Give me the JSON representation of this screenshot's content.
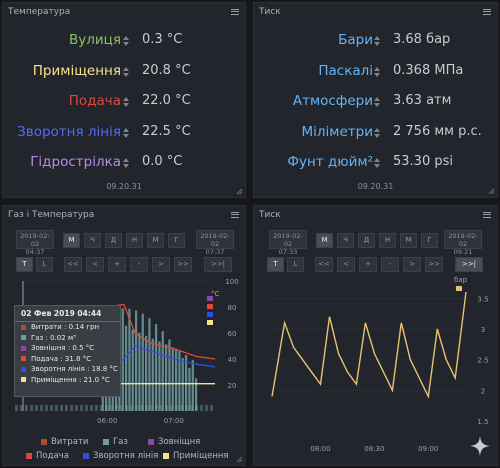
{
  "panels": {
    "temp": {
      "title": "Температура",
      "timestamp": "09.20.31",
      "rows": [
        {
          "label": "Вулиця",
          "value": "0.3 °C",
          "color": "#88c265"
        },
        {
          "label": "Приміщення",
          "value": "20.8 °C",
          "color": "#f2e48e"
        },
        {
          "label": "Подача",
          "value": "22.0 °C",
          "color": "#e0473f"
        },
        {
          "label": "Зворотня лінія",
          "value": "22.5 °C",
          "color": "#4f6ff0"
        },
        {
          "label": "Гідрострілка",
          "value": "0.0 °C",
          "color": "#b98ce8"
        }
      ]
    },
    "pressure": {
      "title": "Тиск",
      "timestamp": "09.20.31",
      "rows": [
        {
          "label": "Бари",
          "value": "3.68 бар",
          "color": "#66b3f4"
        },
        {
          "label": "Паскалі",
          "value": "0.368 МПа",
          "color": "#66b3f4"
        },
        {
          "label": "Атмосфери",
          "value": "3.63 атм",
          "color": "#66b3f4"
        },
        {
          "label": "Міліметри",
          "value": "2 756 мм р.с.",
          "color": "#66b3f4"
        },
        {
          "label": "Фунт дюйм²",
          "value": "53.30 psi",
          "color": "#66b3f4"
        }
      ]
    },
    "gas": {
      "title": "Газ і Температура",
      "date_from": {
        "d": "2019-02-02",
        "t": "04:37"
      },
      "date_to": {
        "d": "2019-02-02",
        "t": "07:37"
      },
      "ranges": [
        "М",
        "Ч",
        "Д",
        "Н",
        "М",
        "Г"
      ],
      "modes": [
        "T",
        "L"
      ],
      "nav": [
        "<<",
        "<",
        "+",
        "-",
        ">",
        ">>",
        ">>|"
      ],
      "unit": "°C",
      "yticks": [
        "100",
        "80",
        "60",
        "40",
        "20"
      ],
      "xticks": [
        "06:00",
        "07:00"
      ],
      "legend": [
        {
          "label": "Витрати",
          "color": "#a0522d"
        },
        {
          "label": "Газ",
          "color": "#6e9fa2"
        },
        {
          "label": "Зовніщня",
          "color": "#8e44ad"
        },
        {
          "label": "Подача",
          "color": "#e0473f"
        },
        {
          "label": "Зворотня лінія",
          "color": "#2f4fe0"
        },
        {
          "label": "Приміщення",
          "color": "#f2e48e"
        }
      ],
      "tooltip": {
        "title": "02 Фев 2019 04:44",
        "lines": [
          {
            "text": "Витрати : 0.14 грн",
            "color": "#a0522d"
          },
          {
            "text": "Газ : 0.02 м³",
            "color": "#6e9fa2"
          },
          {
            "text": "Зовнішня : 0.5 °C",
            "color": "#8e44ad"
          },
          {
            "text": "Подача : 31.8 °C",
            "color": "#e0473f"
          },
          {
            "text": "Зворотня лінія : 18.8 °C",
            "color": "#2f4fe0"
          },
          {
            "text": "Приміщення : 21.0 °C",
            "color": "#f2e48e"
          }
        ]
      }
    },
    "pchart": {
      "title": "Тиск",
      "date_from": {
        "d": "2019-02-02",
        "t": "07:33"
      },
      "date_to": {
        "d": "2019-02-02",
        "t": "09:21"
      },
      "ranges": [
        "М",
        "Ч",
        "Д",
        "Н",
        "М",
        "Г"
      ],
      "modes": [
        "T",
        "L"
      ],
      "nav": [
        "<<",
        "<",
        "+",
        "-",
        ">",
        ">>",
        ">>|"
      ],
      "unit": "бар",
      "yticks": [
        "3.5",
        "3",
        "2.5",
        "2",
        "1.5"
      ],
      "xticks": [
        "08:00",
        "08:30",
        "09:00"
      ],
      "line_color": "#e8c270"
    }
  },
  "chart_data": [
    {
      "type": "line",
      "title": "Газ і Температура",
      "xlabel": "",
      "ylabel": "°C",
      "x_ticks": [
        "06:00",
        "07:00"
      ],
      "ylim": [
        0,
        100
      ],
      "series": [
        {
          "name": "Подача",
          "x": [
            "04:40",
            "05:30",
            "05:55",
            "06:00",
            "06:15",
            "06:25",
            "06:40",
            "07:00",
            "07:20",
            "07:37"
          ],
          "values": [
            28,
            26,
            32,
            80,
            82,
            60,
            52,
            48,
            42,
            40
          ]
        },
        {
          "name": "Зворотня лінія",
          "x": [
            "04:40",
            "05:30",
            "05:55",
            "06:00",
            "06:15",
            "06:25",
            "06:40",
            "07:00",
            "07:20",
            "07:37"
          ],
          "values": [
            18,
            18,
            20,
            28,
            40,
            50,
            46,
            40,
            36,
            34
          ]
        },
        {
          "name": "Приміщення",
          "x": [
            "04:40",
            "07:37"
          ],
          "values": [
            21,
            21
          ]
        },
        {
          "name": "Газ",
          "x": [
            "05:55",
            "06:00",
            "06:15",
            "06:25",
            "06:40",
            "07:00",
            "07:20"
          ],
          "values": [
            70,
            75,
            78,
            72,
            60,
            45,
            30
          ]
        }
      ]
    },
    {
      "type": "line",
      "title": "Тиск",
      "ylabel": "бар",
      "x_ticks": [
        "08:00",
        "08:30",
        "09:00"
      ],
      "ylim": [
        1.5,
        3.7
      ],
      "series": [
        {
          "name": "бар",
          "x": [
            "07:33",
            "07:40",
            "07:45",
            "07:50",
            "07:55",
            "08:00",
            "08:05",
            "08:10",
            "08:15",
            "08:20",
            "08:25",
            "08:30",
            "08:35",
            "08:40",
            "08:45",
            "08:50",
            "08:55",
            "09:00",
            "09:05",
            "09:10",
            "09:15",
            "09:21"
          ],
          "values": [
            1.9,
            3.1,
            2.7,
            2.5,
            2.3,
            2.1,
            3.2,
            2.6,
            2.3,
            2.1,
            3.1,
            2.6,
            2.3,
            2.0,
            3.1,
            2.5,
            2.2,
            1.9,
            3.0,
            2.5,
            2.2,
            3.6
          ]
        }
      ]
    }
  ]
}
